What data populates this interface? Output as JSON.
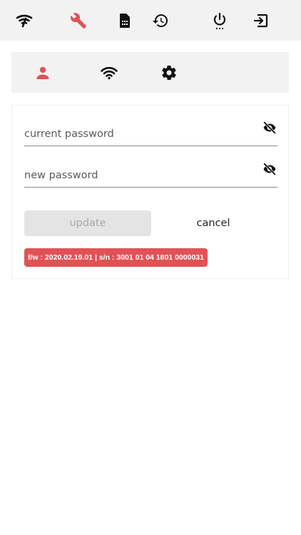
{
  "topbar": {
    "icons": [
      "signal-icon",
      "wrench-icon",
      "sim-card-icon",
      "history-icon",
      "power-menu-icon",
      "logout-icon"
    ],
    "active": "wrench-icon"
  },
  "subbar": {
    "icons": [
      "user-icon",
      "wifi-icon",
      "gear-icon"
    ],
    "active": "user-icon"
  },
  "form": {
    "current_password_placeholder": "current password",
    "new_password_placeholder": "new password",
    "update_label": "update",
    "cancel_label": "cancel"
  },
  "info_badge": "f/w : 2020.02.19.01 | s/n : 3001 01 04 1801 0000031",
  "colors": {
    "accent": "#e05256",
    "icon_default": "#111111",
    "bar_background": "#f2f2f2",
    "disabled_button": "#e4e4e4"
  }
}
